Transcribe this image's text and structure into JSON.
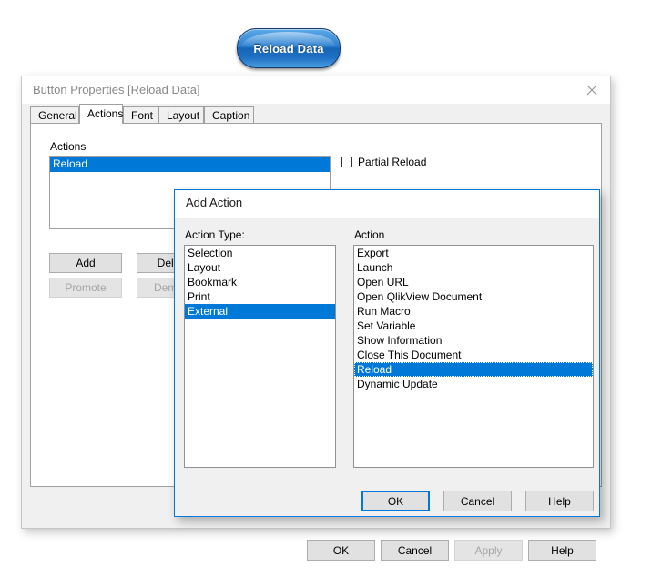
{
  "canvas": {
    "background": "#ffffff"
  },
  "reload_button": {
    "label": "Reload Data",
    "accent": "#1f72c4",
    "text_color": "#ffffff"
  },
  "main_dialog": {
    "title": "Button Properties [Reload Data]",
    "close_icon": "close-icon",
    "tabs": [
      {
        "label": "General",
        "selected": false
      },
      {
        "label": "Actions",
        "selected": true
      },
      {
        "label": "Font",
        "selected": false
      },
      {
        "label": "Layout",
        "selected": false
      },
      {
        "label": "Caption",
        "selected": false
      }
    ],
    "actions_group_label": "Actions",
    "actions_list": [
      {
        "label": "Reload",
        "selected": true
      }
    ],
    "partial_reload": {
      "label": "Partial Reload",
      "checked": false
    },
    "side_buttons": [
      {
        "label": "Add",
        "enabled": true
      },
      {
        "label": "Delete",
        "enabled": true
      },
      {
        "label": "Promote",
        "enabled": false
      },
      {
        "label": "Demote",
        "enabled": false
      }
    ],
    "bottom_buttons": [
      {
        "label": "OK",
        "enabled": true
      },
      {
        "label": "Cancel",
        "enabled": true
      },
      {
        "label": "Apply",
        "enabled": false
      },
      {
        "label": "Help",
        "enabled": true
      }
    ]
  },
  "add_action_dialog": {
    "title": "Add Action",
    "border_color": "#0078d7",
    "action_type_label": "Action Type:",
    "action_label": "Action",
    "action_types": [
      {
        "label": "Selection",
        "selected": false
      },
      {
        "label": "Layout",
        "selected": false
      },
      {
        "label": "Bookmark",
        "selected": false
      },
      {
        "label": "Print",
        "selected": false
      },
      {
        "label": "External",
        "selected": true
      }
    ],
    "actions": [
      {
        "label": "Export",
        "selected": false
      },
      {
        "label": "Launch",
        "selected": false
      },
      {
        "label": "Open URL",
        "selected": false
      },
      {
        "label": "Open QlikView Document",
        "selected": false
      },
      {
        "label": "Run Macro",
        "selected": false
      },
      {
        "label": "Set Variable",
        "selected": false
      },
      {
        "label": "Show Information",
        "selected": false
      },
      {
        "label": "Close This Document",
        "selected": false
      },
      {
        "label": "Reload",
        "selected": true
      },
      {
        "label": "Dynamic Update",
        "selected": false
      }
    ],
    "buttons": [
      {
        "label": "OK",
        "default": true
      },
      {
        "label": "Cancel",
        "default": false
      },
      {
        "label": "Help",
        "default": false
      }
    ],
    "selection_color": "#0078d7"
  }
}
